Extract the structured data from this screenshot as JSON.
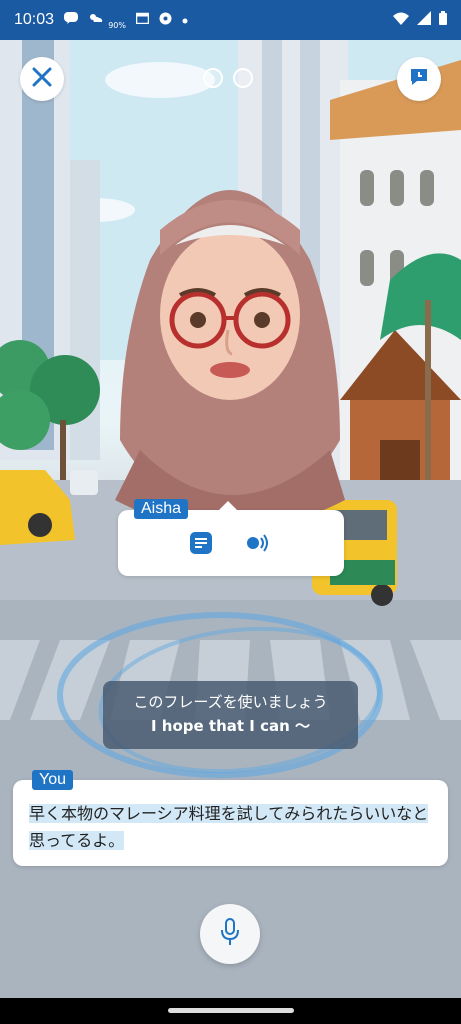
{
  "status_bar": {
    "time": "10:03",
    "battery_badge": "90%",
    "icons": [
      "line-icon",
      "weather-icon",
      "calendar-icon",
      "soccer-icon",
      "dot-icon",
      "wifi-icon",
      "signal-icon",
      "battery-icon"
    ]
  },
  "header": {
    "close_icon": "close-icon",
    "hint_icon": "chat-hint-icon",
    "progress_dots": 2
  },
  "character": {
    "name": "Aisha",
    "actions": [
      {
        "icon": "transcript-icon"
      },
      {
        "icon": "audio-icon"
      }
    ]
  },
  "phrase_hint": {
    "line1": "このフレーズを使いましょう",
    "line2": "I hope that I can 〜"
  },
  "user": {
    "label": "You",
    "answer": "早く本物のマレーシア料理を試してみられたらいいなと思ってるよ。"
  },
  "mic": {
    "icon": "microphone-icon"
  },
  "colors": {
    "status_bar": "#1a5aa3",
    "accent_blue": "#1f74c6",
    "highlight": "#d2e8f7",
    "phrase_box": "#46586e"
  }
}
